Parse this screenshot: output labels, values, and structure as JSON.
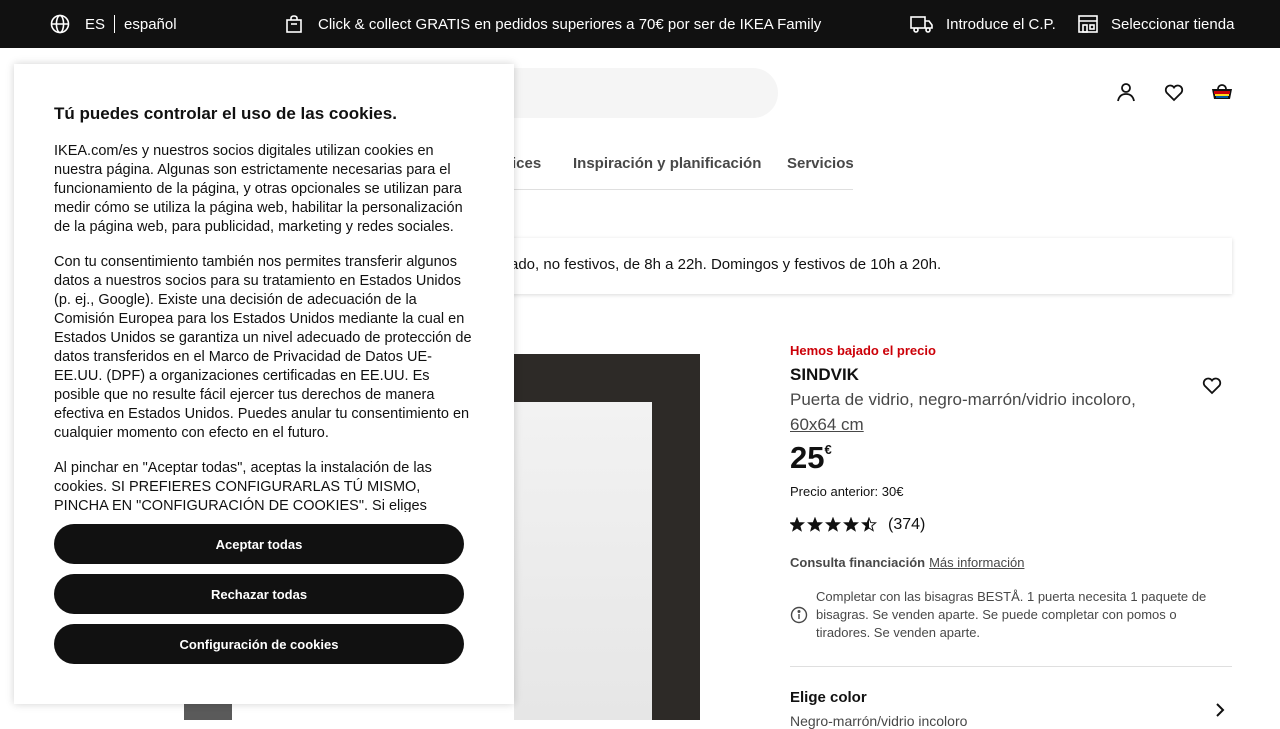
{
  "topbar": {
    "lang_code": "ES",
    "lang_name": "español",
    "promo": "Click & collect GRATIS en pedidos superiores a 70€ por ser de IKEA Family",
    "postcode": "Introduce el C.P.",
    "store": "Seleccionar tienda"
  },
  "nav": {
    "item_partial": "ices",
    "inspiration": "Inspiración y planificación",
    "services": "Servicios"
  },
  "info_banner": "ado, no festivos, de 8h a 22h. Domingos y festivos de 10h a 20h.",
  "product": {
    "lowered_label": "Hemos bajado el precio",
    "name": "SINDVIK",
    "description": "Puerta de vidrio, negro-marrón/vidrio incoloro,",
    "size": "60x64 cm",
    "price": "25",
    "currency": "€",
    "previous_price": "Precio anterior: 30€",
    "rating": 4.5,
    "rating_count": "(374)",
    "financing_label": "Consulta financiación",
    "financing_link": "Más información",
    "note": "Completar con las bisagras BESTÅ. 1 puerta necesita 1 paquete de bisagras. Se venden aparte. Se puede completar con pomos o tiradores. Se venden aparte.",
    "choose_color": "Elige color",
    "color_value": "Negro-marrón/vidrio incoloro"
  },
  "cookie_modal": {
    "title": "Tú puedes controlar el uso de las cookies.",
    "paragraphs": [
      "IKEA.com/es y nuestros socios digitales utilizan cookies en nuestra página. Algunas son estrictamente necesarias para el funcionamiento de la página, y otras opcionales se utilizan para medir cómo se utiliza la página web, habilitar la personalización de la página web, para publicidad, marketing y redes sociales.",
      "Con tu consentimiento también nos permites transferir algunos datos a nuestros socios para su tratamiento en Estados Unidos (p. ej., Google). Existe una decisión de adecuación de la Comisión Europea para los Estados Unidos mediante la cual en Estados Unidos se garantiza un nivel adecuado de protección de datos transferidos en el Marco de Privacidad de Datos UE-EE.UU. (DPF) a organizaciones certificadas en EE.UU. Es posible que no resulte fácil ejercer tus derechos de manera efectiva en Estados Unidos. Puedes anular tu consentimiento en cualquier momento con efecto en el futuro.",
      "Al pinchar en \"Aceptar todas\", aceptas la instalación de las cookies. SI PREFIERES CONFIGURARLAS TÚ MISMO, PINCHA EN \"CONFIGURACIÓN DE COOKIES\". Si eliges “Rechazar todas” sólo"
    ],
    "accept_all": "Aceptar todas",
    "reject_all": "Rechazar todas",
    "settings": "Configuración de cookies"
  },
  "colors": {
    "topbar_bg": "#111111",
    "button_bg": "#111111",
    "price_drop_red": "#cc0008",
    "text_secondary": "#484848"
  }
}
